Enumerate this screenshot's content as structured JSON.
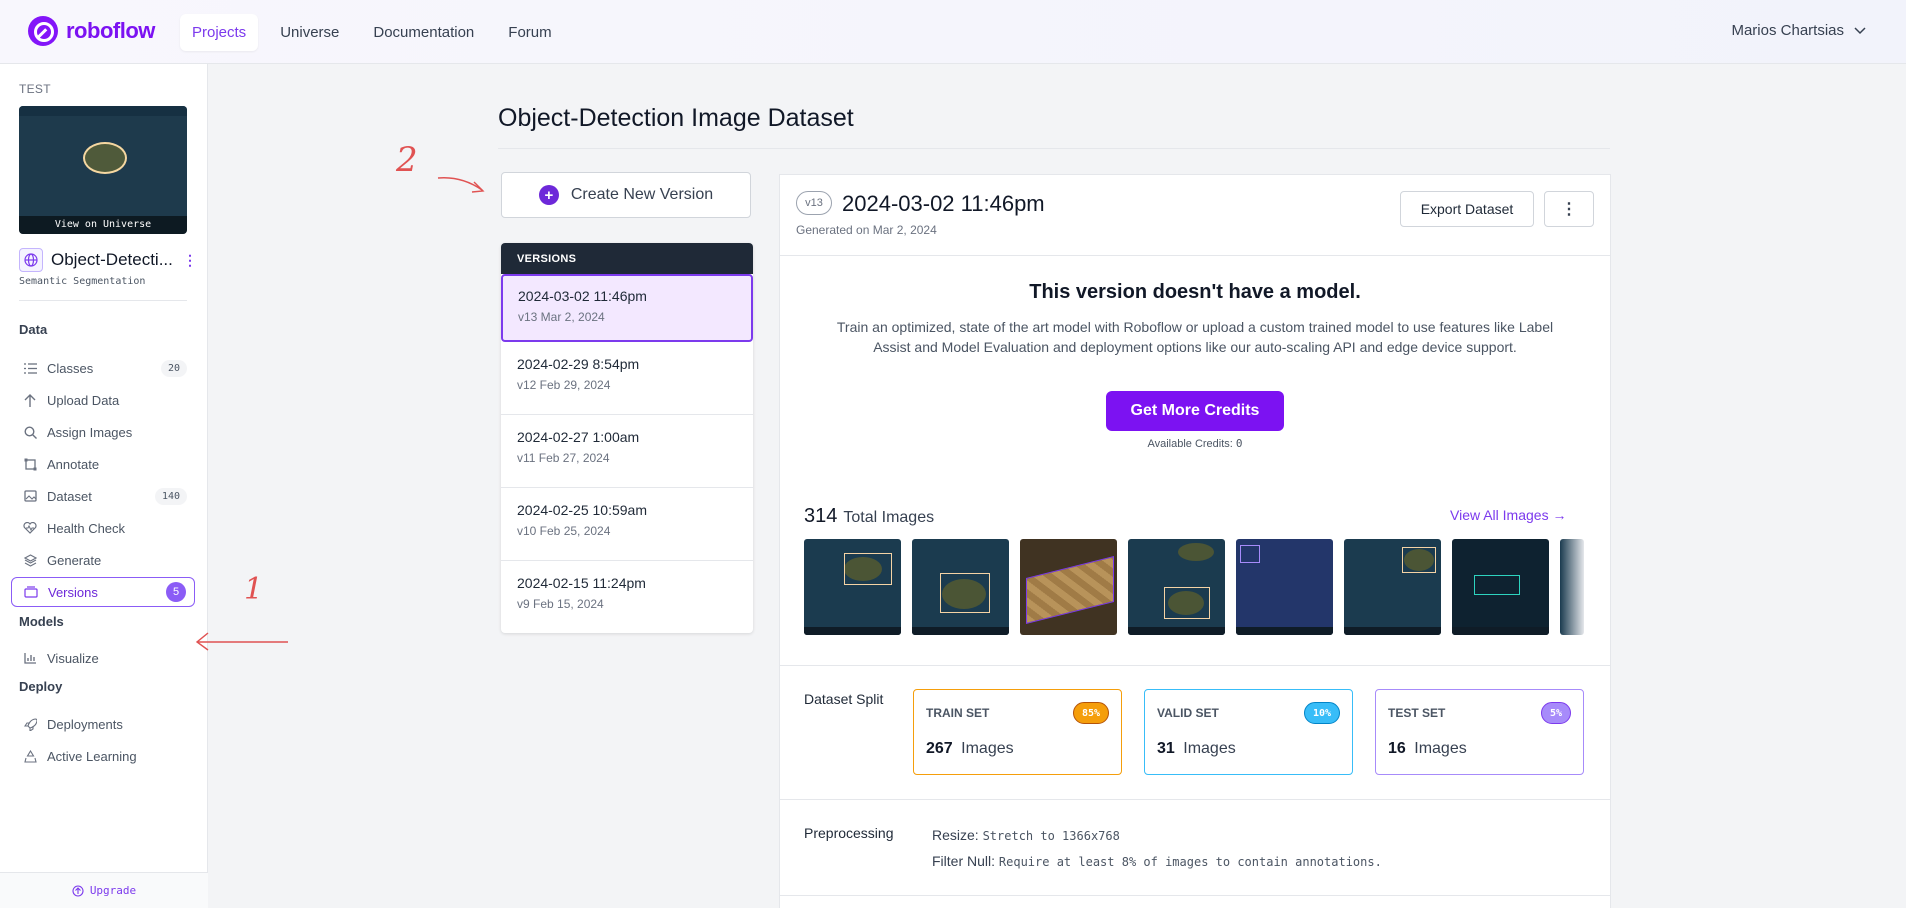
{
  "brand": {
    "name": "roboflow",
    "color": "#7c12f2"
  },
  "nav": {
    "items": [
      "Projects",
      "Universe",
      "Documentation",
      "Forum"
    ],
    "active": "Projects"
  },
  "user": {
    "name": "Marios Chartsias"
  },
  "sidebar": {
    "workspace": "TEST",
    "thumbnail_caption": "View on Universe",
    "project_name": "Object-Detecti...",
    "project_type": "Semantic Segmentation",
    "sections": {
      "data": "Data",
      "models": "Models",
      "deploy": "Deploy"
    },
    "items": [
      {
        "label": "Classes",
        "icon": "list-icon",
        "count": "20"
      },
      {
        "label": "Upload Data",
        "icon": "upload-icon"
      },
      {
        "label": "Assign Images",
        "icon": "search-icon"
      },
      {
        "label": "Annotate",
        "icon": "annotate-icon"
      },
      {
        "label": "Dataset",
        "icon": "images-icon",
        "count": "140"
      },
      {
        "label": "Health Check",
        "icon": "heart-pulse-icon"
      },
      {
        "label": "Generate",
        "icon": "layers-icon"
      },
      {
        "label": "Versions",
        "icon": "versions-icon",
        "count": "5"
      },
      {
        "label": "Visualize",
        "icon": "chart-icon"
      },
      {
        "label": "Deployments",
        "icon": "rocket-icon"
      },
      {
        "label": "Active Learning",
        "icon": "recycle-icon"
      }
    ],
    "upgrade": "Upgrade"
  },
  "main": {
    "title": "Object-Detection Image Dataset",
    "create_button": "Create New Version",
    "versions_header": "VERSIONS",
    "versions": [
      {
        "date": "2024-03-02 11:46pm",
        "sub": "v13 Mar 2, 2024"
      },
      {
        "date": "2024-02-29 8:54pm",
        "sub": "v12 Feb 29, 2024"
      },
      {
        "date": "2024-02-27 1:00am",
        "sub": "v11 Feb 27, 2024"
      },
      {
        "date": "2024-02-25 10:59am",
        "sub": "v10 Feb 25, 2024"
      },
      {
        "date": "2024-02-15 11:24pm",
        "sub": "v9 Feb 15, 2024"
      }
    ]
  },
  "version": {
    "badge": "v13",
    "title": "2024-03-02 11:46pm",
    "generated": "Generated on Mar 2, 2024",
    "export_button": "Export Dataset",
    "more_button": "⋮",
    "no_model_title": "This version doesn't have a model.",
    "no_model_desc": "Train an optimized, state of the art model with Roboflow or upload a custom trained model to use features like Label Assist and Model Evaluation and deployment options like our auto-scaling API and edge device support.",
    "credits_button": "Get More Credits",
    "credits_label": "Available Credits:",
    "credits_value": "0",
    "total_images": "314",
    "total_label": "Total Images",
    "view_all": "View All Images →",
    "split_label": "Dataset Split",
    "splits": [
      {
        "name": "TRAIN SET",
        "pct": "85%",
        "count": "267",
        "unit": "Images"
      },
      {
        "name": "VALID SET",
        "pct": "10%",
        "count": "31",
        "unit": "Images"
      },
      {
        "name": "TEST SET",
        "pct": "5%",
        "count": "16",
        "unit": "Images"
      }
    ],
    "preprocessing_label": "Preprocessing",
    "resize_label": "Resize:",
    "resize_value": "Stretch to 1366x768",
    "filter_label": "Filter Null:",
    "filter_value": "Require at least 8% of images to contain annotations."
  },
  "annotations": {
    "one": "1",
    "two": "2"
  }
}
